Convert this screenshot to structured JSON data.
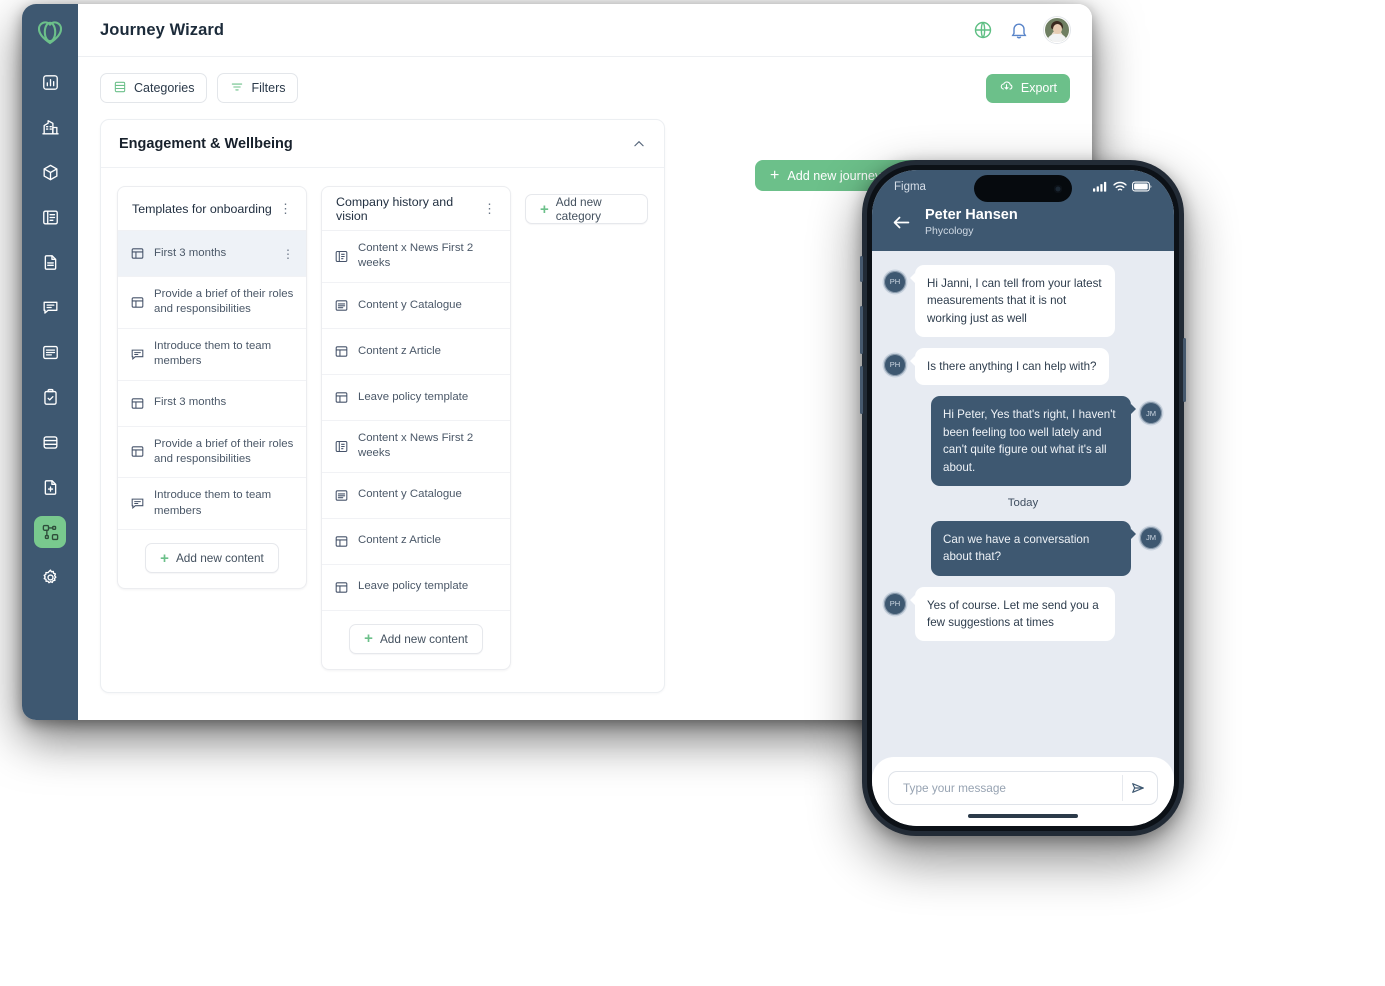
{
  "app": {
    "title": "Journey Wizard",
    "accent_green": "#6cc08a",
    "sidebar_bg": "#3e5871",
    "logo_name": "heart-loops-logo"
  },
  "sidebar": {
    "items": [
      {
        "icon": "chart-bar-icon",
        "name": "sidebar-item-analytics",
        "active": false
      },
      {
        "icon": "building-icon",
        "name": "sidebar-item-company",
        "active": false
      },
      {
        "icon": "cube-icon",
        "name": "sidebar-item-products",
        "active": false
      },
      {
        "icon": "book-open-icon",
        "name": "sidebar-item-library",
        "active": false
      },
      {
        "icon": "document-icon",
        "name": "sidebar-item-documents",
        "active": false
      },
      {
        "icon": "chat-bubble-icon",
        "name": "sidebar-item-messages",
        "active": false
      },
      {
        "icon": "list-lines-icon",
        "name": "sidebar-item-lists",
        "active": false
      },
      {
        "icon": "clipboard-check-icon",
        "name": "sidebar-item-tasks",
        "active": false
      },
      {
        "icon": "database-icon",
        "name": "sidebar-item-database",
        "active": false
      },
      {
        "icon": "document-plus-icon",
        "name": "sidebar-item-new-document",
        "active": false
      },
      {
        "icon": "workflow-nodes-icon",
        "name": "sidebar-item-journey",
        "active": true
      },
      {
        "icon": "gear-icon",
        "name": "sidebar-item-settings",
        "active": false
      }
    ]
  },
  "topbar": {
    "globe_icon": "globe-icon",
    "bell_icon": "bell-icon",
    "avatar": "user-avatar"
  },
  "toolbar": {
    "categories_label": "Categories",
    "categories_icon": "list-rows-icon",
    "filters_label": "Filters",
    "filters_icon": "filter-icon",
    "export_label": "Export",
    "export_icon": "cloud-download-icon"
  },
  "add_phase": {
    "label": "Add new journey phase",
    "plus": "+"
  },
  "phase": {
    "title": "Engagement & Wellbeing",
    "chevron": "chevron-up-icon"
  },
  "add_category": {
    "label": "Add new category",
    "plus": "+"
  },
  "columns": [
    {
      "title": "Templates for onboarding",
      "menu": "⋮",
      "add_label": "Add new content",
      "rows": [
        {
          "text": "First 3 months",
          "icon": "layout-template-icon",
          "selected": true,
          "menu": "⋮"
        },
        {
          "text": "Provide a brief of their roles and responsibilities",
          "icon": "layout-template-icon",
          "selected": false,
          "menu": ""
        },
        {
          "text": "Introduce them to team members",
          "icon": "chat-bubble-icon",
          "selected": false,
          "menu": ""
        },
        {
          "text": "First 3 months",
          "icon": "layout-template-icon",
          "selected": false,
          "menu": ""
        },
        {
          "text": "Provide a brief of their roles and responsibilities",
          "icon": "layout-template-icon",
          "selected": false,
          "menu": ""
        },
        {
          "text": "Introduce them to team members",
          "icon": "chat-bubble-icon",
          "selected": false,
          "menu": ""
        }
      ]
    },
    {
      "title": "Company history and vision",
      "menu": "⋮",
      "add_label": "Add new content",
      "rows": [
        {
          "text": "Content x News First 2 weeks",
          "icon": "book-open-icon",
          "selected": false,
          "menu": ""
        },
        {
          "text": "Content y Catalogue",
          "icon": "list-lines-icon",
          "selected": false,
          "menu": ""
        },
        {
          "text": "Content z Article",
          "icon": "layout-template-icon",
          "selected": false,
          "menu": ""
        },
        {
          "text": "Leave policy template",
          "icon": "layout-template-icon",
          "selected": false,
          "menu": ""
        },
        {
          "text": "Content x News First 2 weeks",
          "icon": "book-open-icon",
          "selected": false,
          "menu": ""
        },
        {
          "text": "Content y Catalogue",
          "icon": "list-lines-icon",
          "selected": false,
          "menu": ""
        },
        {
          "text": "Content z Article",
          "icon": "layout-template-icon",
          "selected": false,
          "menu": ""
        },
        {
          "text": "Leave policy template",
          "icon": "layout-template-icon",
          "selected": false,
          "menu": ""
        }
      ]
    }
  ],
  "phone": {
    "status": {
      "app_name": "Figma",
      "signal_icon": "cellular-signal-icon",
      "wifi_icon": "wifi-icon",
      "battery_icon": "battery-icon"
    },
    "chat_header": {
      "back_icon": "back-arrow-icon",
      "name": "Peter Hansen",
      "role": "Phycology"
    },
    "messages": [
      {
        "side": "in",
        "avatar": "PH",
        "text": "Hi Janni, I can tell from your latest measurements that it is not working just as well"
      },
      {
        "side": "in",
        "avatar": "PH",
        "text": "Is there anything I can help with?"
      },
      {
        "side": "out",
        "avatar": "JM",
        "text": "Hi Peter, Yes that's right, I haven't been feeling too well lately and can't quite figure out what it's all about."
      },
      {
        "side": "sep",
        "avatar": "",
        "text": "Today"
      },
      {
        "side": "out",
        "avatar": "JM",
        "text": "Can we have a conversation about that?"
      },
      {
        "side": "in",
        "avatar": "PH",
        "text": "Yes of course. Let me send you a few suggestions at times"
      }
    ],
    "composer": {
      "placeholder": "Type your message",
      "value": "",
      "send_icon": "send-paper-plane-icon"
    }
  }
}
